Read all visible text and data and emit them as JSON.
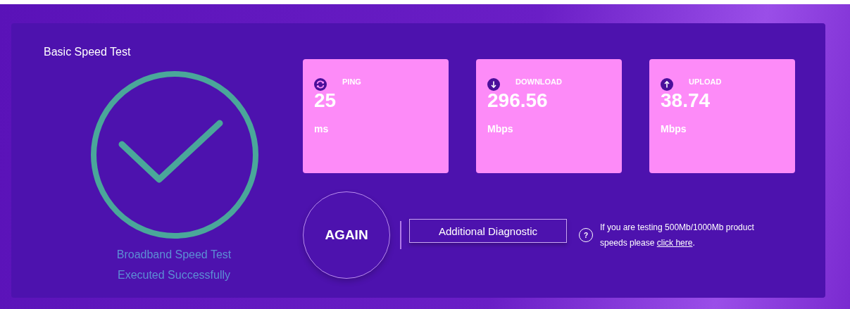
{
  "title": "Basic Speed Test",
  "status": {
    "lines": [
      "Broadband Speed Test",
      "Executed Successfully"
    ]
  },
  "metrics": [
    {
      "kind": "ping",
      "label": "PING",
      "value": "25",
      "unit": "ms"
    },
    {
      "kind": "download",
      "label": "DOWNLOAD",
      "value": "296.56",
      "unit": "Mbps"
    },
    {
      "kind": "upload",
      "label": "UPLOAD",
      "value": "38.74",
      "unit": "Mbps"
    }
  ],
  "again_button": "AGAIN",
  "diagnostic_button": "Additional Diagnostic",
  "help": {
    "icon": "?",
    "text_before": "If you are testing 500Mb/1000Mb product speeds please ",
    "link": "click here",
    "text_after": "."
  }
}
